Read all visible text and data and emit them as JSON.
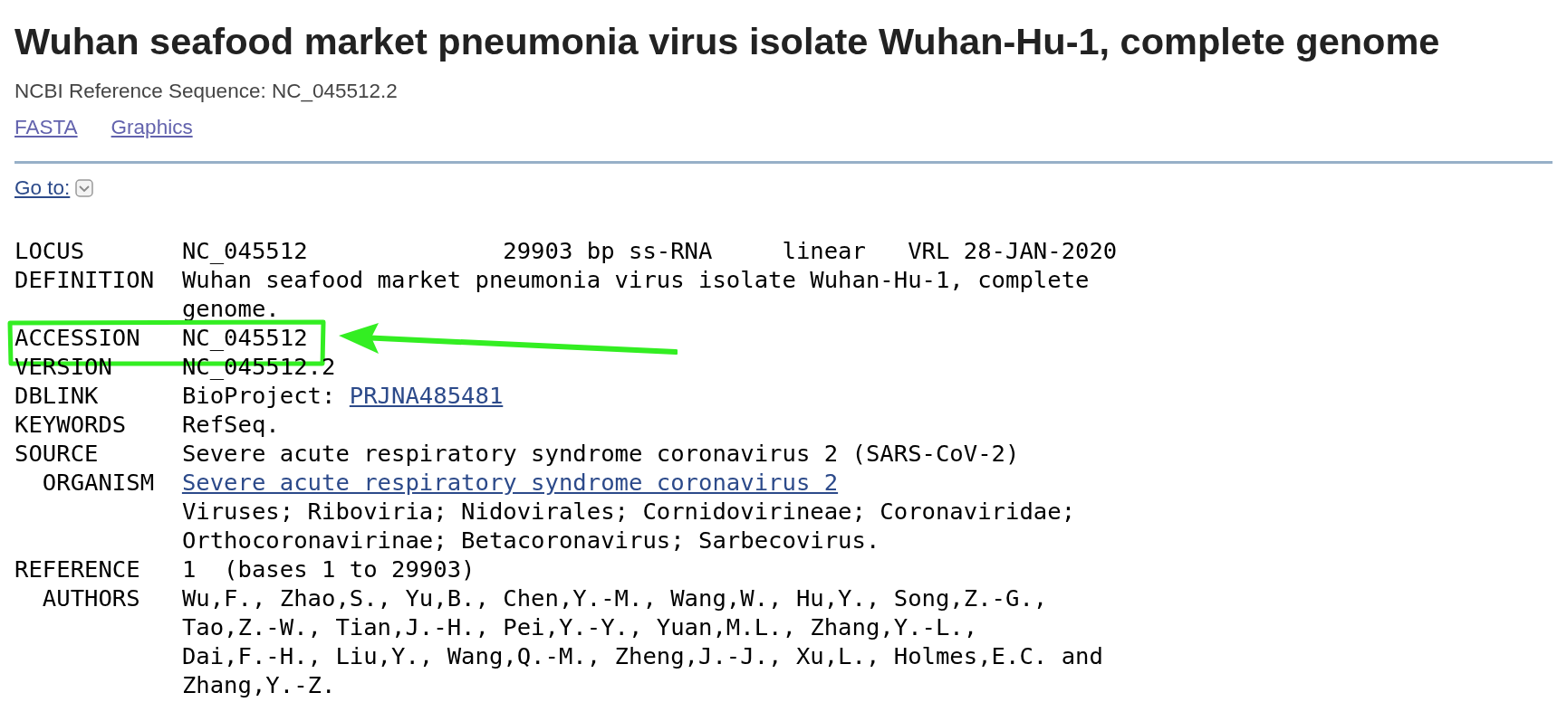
{
  "title": "Wuhan seafood market pneumonia virus isolate Wuhan-Hu-1, complete genome",
  "subtitle": "NCBI Reference Sequence: NC_045512.2",
  "links": [
    "FASTA",
    "Graphics"
  ],
  "goto": {
    "label": "Go to:"
  },
  "record": [
    {
      "label": "LOCUS",
      "highlighted": false,
      "lines": [
        {
          "text": "NC_045512              29903 bp ss-RNA     linear   VRL 28-JAN-2020"
        }
      ]
    },
    {
      "label": "DEFINITION",
      "highlighted": false,
      "lines": [
        {
          "text": "Wuhan seafood market pneumonia virus isolate Wuhan-Hu-1, complete"
        },
        {
          "text": "genome."
        }
      ]
    },
    {
      "label": "ACCESSION",
      "highlighted": true,
      "lines": [
        {
          "text": "NC_045512"
        }
      ]
    },
    {
      "label": "VERSION",
      "highlighted": false,
      "lines": [
        {
          "text": "NC_045512.2"
        }
      ]
    },
    {
      "label": "DBLINK",
      "highlighted": false,
      "lines": [
        {
          "text": "BioProject: ",
          "link": "PRJNA485481"
        }
      ]
    },
    {
      "label": "KEYWORDS",
      "highlighted": false,
      "lines": [
        {
          "text": "RefSeq."
        }
      ]
    },
    {
      "label": "SOURCE",
      "highlighted": false,
      "lines": [
        {
          "text": "Severe acute respiratory syndrome coronavirus 2 (SARS-CoV-2)"
        }
      ],
      "children": [
        {
          "label": "ORGANISM",
          "highlighted": false,
          "lines": [
            {
              "link": "Severe acute respiratory syndrome coronavirus 2"
            },
            {
              "text": "Viruses; Riboviria; Nidovirales; Cornidovirineae; Coronaviridae;"
            },
            {
              "text": "Orthocoronavirinae; Betacoronavirus; Sarbecovirus."
            }
          ]
        }
      ]
    },
    {
      "label": "REFERENCE",
      "highlighted": false,
      "lines": [
        {
          "text": "1  (bases 1 to 29903)"
        }
      ],
      "children": [
        {
          "label": "AUTHORS",
          "highlighted": false,
          "lines": [
            {
              "text": "Wu,F., Zhao,S., Yu,B., Chen,Y.-M., Wang,W., Hu,Y., Song,Z.-G.,"
            },
            {
              "text": "Tao,Z.-W., Tian,J.-H., Pei,Y.-Y., Yuan,M.L., Zhang,Y.-L.,"
            },
            {
              "text": "Dai,F.-H., Liu,Y., Wang,Q.-M., Zheng,J.-J., Xu,L., Holmes,E.C. and"
            },
            {
              "text": "Zhang,Y.-Z."
            }
          ]
        }
      ]
    }
  ]
}
